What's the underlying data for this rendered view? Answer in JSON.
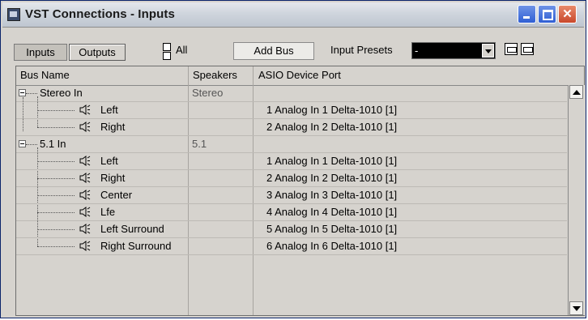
{
  "window": {
    "title": "VST Connections - Inputs",
    "app_icon": "vst-window-icon",
    "buttons": [
      "minimize-icon",
      "maximize-icon",
      "close-icon"
    ]
  },
  "toolbar": {
    "tabs": [
      {
        "label": "Inputs",
        "active": true
      },
      {
        "label": "Outputs",
        "active": false
      }
    ],
    "all_label": "All",
    "add_bus_label": "Add Bus",
    "presets_label": "Input Presets",
    "presets_value": "-",
    "preset_store_icon": "store-preset-icon",
    "preset_remove_icon": "remove-preset-icon"
  },
  "table": {
    "columns": [
      "Bus Name",
      "Speakers",
      "ASIO Device Port"
    ],
    "buses": [
      {
        "name": "Stereo In",
        "speakers": "Stereo",
        "channels": [
          {
            "name": "Left",
            "port": "1 Analog In 1 Delta-1010 [1]"
          },
          {
            "name": "Right",
            "port": "2 Analog In 2 Delta-1010 [1]"
          }
        ]
      },
      {
        "name": "5.1 In",
        "speakers": "5.1",
        "channels": [
          {
            "name": "Left",
            "port": "1 Analog In 1 Delta-1010 [1]"
          },
          {
            "name": "Right",
            "port": "2 Analog In 2 Delta-1010 [1]"
          },
          {
            "name": "Center",
            "port": "3 Analog In 3 Delta-1010 [1]"
          },
          {
            "name": "Lfe",
            "port": "4 Analog In 4 Delta-1010 [1]"
          },
          {
            "name": "Left Surround",
            "port": "5 Analog In 5 Delta-1010 [1]"
          },
          {
            "name": "Right Surround",
            "port": "6 Analog In 6 Delta-1010 [1]"
          }
        ]
      }
    ]
  },
  "colors": {
    "window_bg": "#d6d3ce",
    "title_buttons": "#2f5fd4",
    "close_button": "#c9482b"
  }
}
